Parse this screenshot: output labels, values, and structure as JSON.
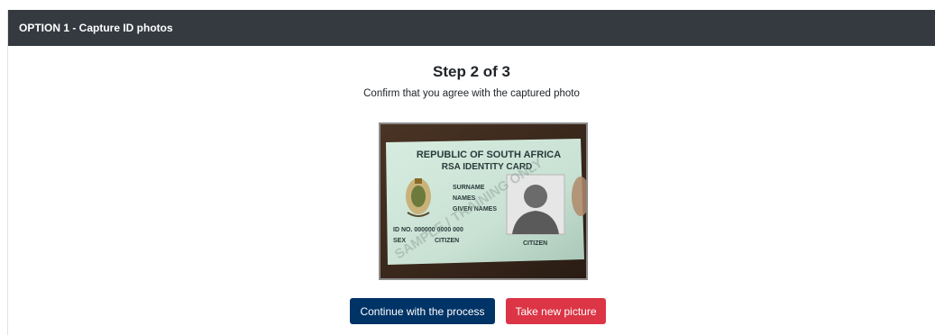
{
  "header": {
    "title": "OPTION 1 - Capture ID photos"
  },
  "step": {
    "title": "Step 2 of 3",
    "subtitle": "Confirm that you agree with the captured photo"
  },
  "id_card": {
    "line1": "REPUBLIC OF SOUTH AFRICA",
    "line2": "RSA IDENTITY CARD",
    "surname": "SURNAME",
    "names": "NAMES",
    "given_names": "GIVEN NAMES",
    "id_no": "ID NO. 000000 0000 000",
    "sex": "SEX",
    "citizen_left": "CITIZEN",
    "citizen_right": "CITIZEN",
    "watermark": "SAMPLE / TRAINING ONLY"
  },
  "actions": {
    "continue_label": "Continue with the process",
    "retake_label": "Take new picture"
  },
  "colors": {
    "header_bg": "#343a40",
    "continue_bg": "#003366",
    "retake_bg": "#dc3545"
  }
}
